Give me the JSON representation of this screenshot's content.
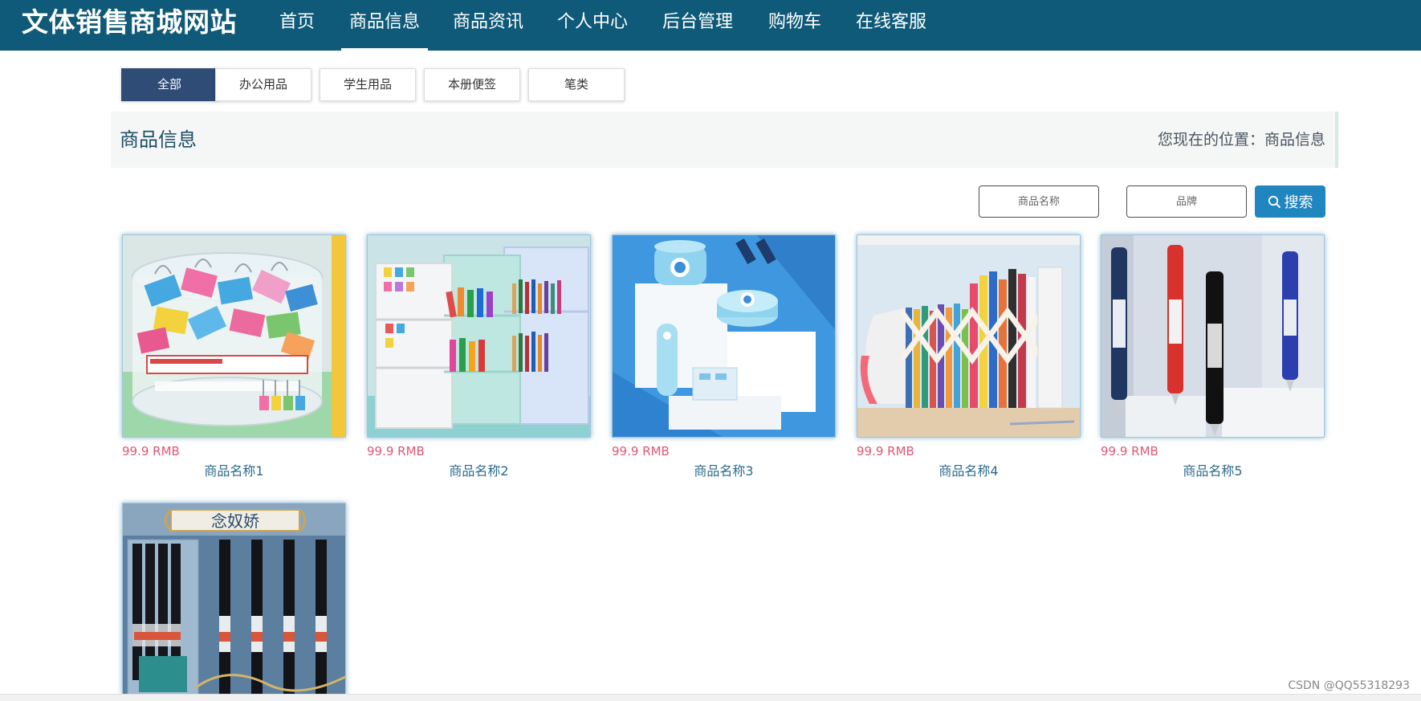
{
  "header": {
    "brand": "文体销售商城网站",
    "nav": [
      {
        "label": "首页"
      },
      {
        "label": "商品信息"
      },
      {
        "label": "商品资讯"
      },
      {
        "label": "个人中心"
      },
      {
        "label": "后台管理"
      },
      {
        "label": "购物车"
      },
      {
        "label": "在线客服"
      }
    ],
    "active_nav": "商品信息"
  },
  "categories": [
    {
      "label": "全部"
    },
    {
      "label": "办公用品"
    },
    {
      "label": "学生用品"
    },
    {
      "label": "本册便签"
    },
    {
      "label": "笔类"
    }
  ],
  "titlebar": {
    "title": "商品信息",
    "breadcrumb": "您现在的位置：商品信息"
  },
  "search": {
    "name_placeholder": "商品名称",
    "brand_placeholder": "品牌",
    "button_label": "搜索",
    "icon": "search-icon"
  },
  "products": [
    {
      "price": "99.9 RMB",
      "name": "商品名称1",
      "image": "binder-clips-jar"
    },
    {
      "price": "99.9 RMB",
      "name": "商品名称2",
      "image": "desk-pen-organizer"
    },
    {
      "price": "99.9 RMB",
      "name": "商品名称3",
      "image": "doraemon-desk-gadgets"
    },
    {
      "price": "99.9 RMB",
      "name": "商品名称4",
      "image": "expandable-bookend"
    },
    {
      "price": "99.9 RMB",
      "name": "商品名称5",
      "image": "gel-pens"
    },
    {
      "price": "",
      "name": "",
      "image": "niannujiao-pen-set",
      "image_text": "念奴娇"
    }
  ],
  "watermark": "CSDN @QQ55318293",
  "colors": {
    "navbar": "#0f5a78",
    "active_category": "#2f4c77",
    "search_button": "#1f86bf",
    "price": "#e05774",
    "product_name": "#2b6a8c"
  }
}
